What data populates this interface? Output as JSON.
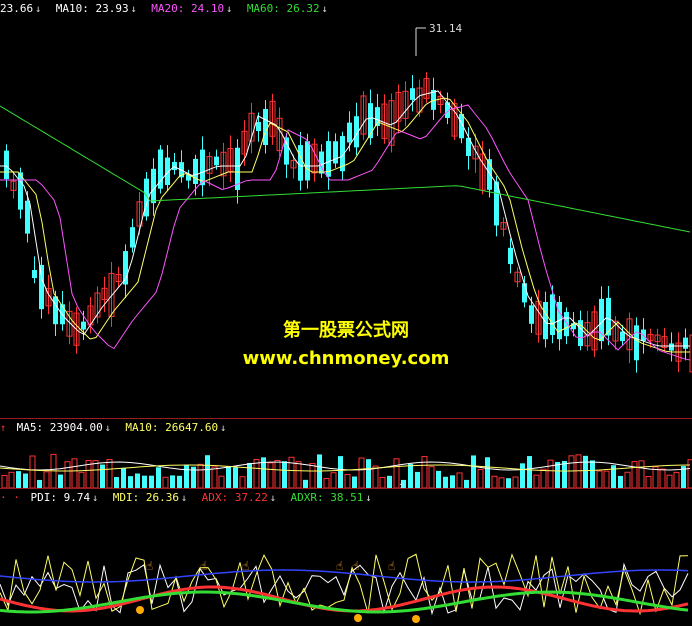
{
  "main": {
    "ma5": {
      "text": "23.66",
      "color": "#ffffff"
    },
    "ma10": {
      "text": "MA10: 23.93",
      "color": "#ffffff"
    },
    "ma20": {
      "text": "MA20: 24.10",
      "color": "#ff55ff"
    },
    "ma60": {
      "text": "MA60: 26.32",
      "color": "#33dd33"
    },
    "peak_label": "31.14",
    "watermark_line1": "第一股票公式网",
    "watermark_line2": "www.chnmoney.com",
    "candles_up_color": "#ff3333",
    "candles_down_color": "#44ffff"
  },
  "volume": {
    "ma5": {
      "text": "MA5: 23904.00",
      "color": "#ffffff"
    },
    "ma10": {
      "text": "MA10: 26647.60",
      "color": "#ffff66"
    }
  },
  "indicator": {
    "pdi": {
      "text": "PDI: 9.74",
      "color": "#ffffff"
    },
    "mdi": {
      "text": "MDI: 26.36",
      "color": "#ffff66"
    },
    "adx": {
      "text": "ADX: 37.22",
      "color": "#ff3333"
    },
    "adxr": {
      "text": "ADXR: 38.51",
      "color": "#33dd33"
    }
  },
  "icons": {
    "down_arrow": "↓",
    "up_arrow": "↑"
  }
}
